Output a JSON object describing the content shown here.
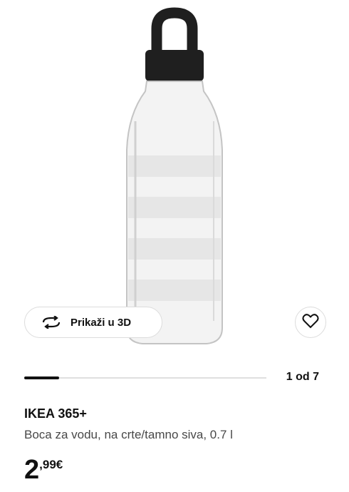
{
  "media": {
    "image": "water-bottle-striped-dark-grey",
    "view_3d_label": "Prikaži u 3D",
    "view_3d_icon": "rotate-3d-icon",
    "favourite_icon": "heart-icon",
    "gallery_progress": 0.143,
    "image_counter": "1 od 7"
  },
  "product": {
    "name": "IKEA 365+",
    "description": "Boca za vodu, na crte/tamno siva, 0.7 l"
  },
  "price": {
    "integer": "2",
    "decimal": ",99",
    "currency": "€"
  }
}
